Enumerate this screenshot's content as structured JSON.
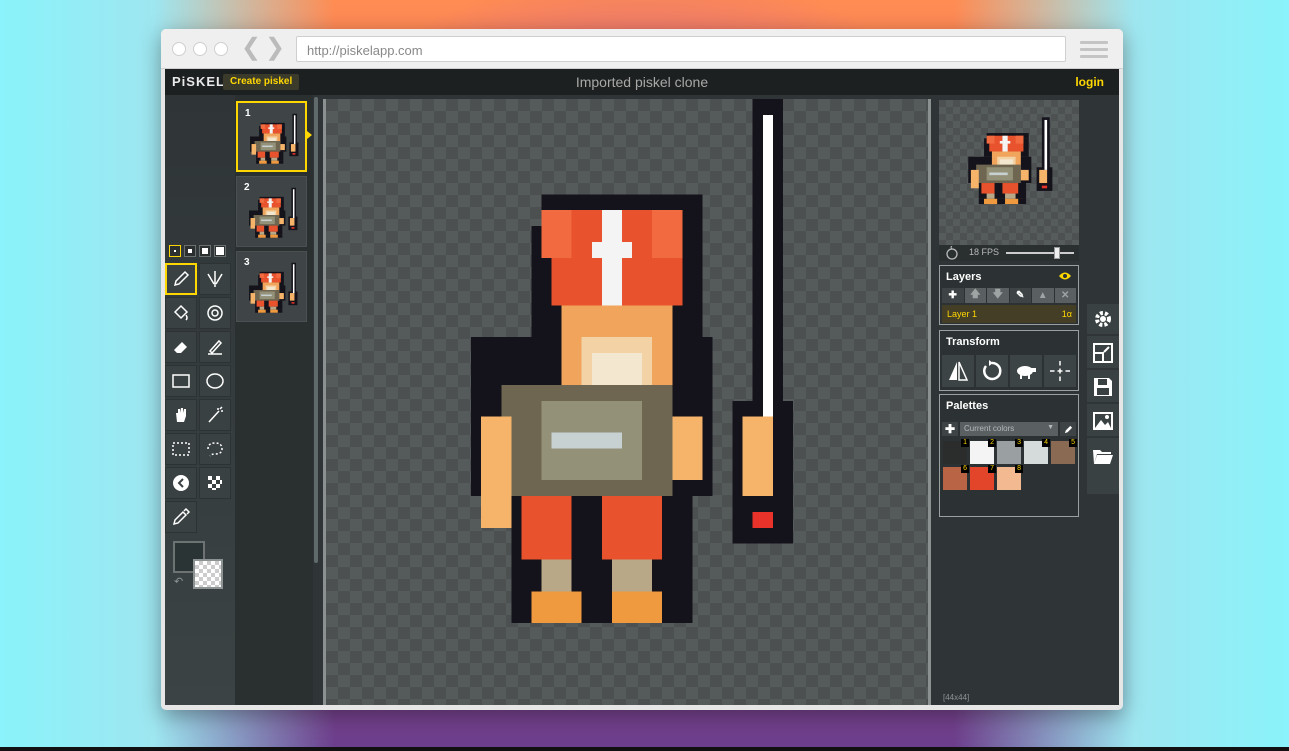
{
  "browser": {
    "url": "http://piskelapp.com"
  },
  "app": {
    "logo": "PiSKEL",
    "create_button": "Create piskel",
    "document_title": "Imported piskel clone",
    "login": "login"
  },
  "tools": {
    "pen_sizes": 4,
    "items": [
      "pen-tool",
      "vertical-mirror-pen-tool",
      "paint-bucket-tool",
      "paint-all-same-color-tool",
      "eraser-tool",
      "stroke-tool",
      "rectangle-tool",
      "circle-tool",
      "move-tool",
      "shape-selection-tool",
      "rectangle-selection-tool",
      "lasso-selection-tool",
      "lighten-tool",
      "dithering-tool",
      "color-picker-tool"
    ],
    "selected": "pen-tool",
    "primary_color": "#2b3434",
    "secondary_color": "transparent"
  },
  "frames": {
    "items": [
      {
        "number": "1"
      },
      {
        "number": "2"
      },
      {
        "number": "3"
      }
    ],
    "selected_index": 0
  },
  "preview": {
    "fps_label": "18 FPS",
    "fps_fraction": 0.75
  },
  "layers": {
    "title": "Layers",
    "items": [
      {
        "name": "Layer 1",
        "opacity": "1α"
      }
    ]
  },
  "transform": {
    "title": "Transform"
  },
  "palettes": {
    "title": "Palettes",
    "selected": "Current colors",
    "swatches": [
      {
        "index": "1",
        "color": "#2b2c2c"
      },
      {
        "index": "2",
        "color": "#f4f4f4"
      },
      {
        "index": "3",
        "color": "#9aa0a2"
      },
      {
        "index": "4",
        "color": "#d5dbdb"
      },
      {
        "index": "5",
        "color": "#8a6a53"
      },
      {
        "index": "6",
        "color": "#b96545"
      },
      {
        "index": "7",
        "color": "#e3452a"
      },
      {
        "index": "8",
        "color": "#f3b990"
      }
    ]
  },
  "canvas": {
    "size_label": "[44x44]"
  },
  "colors": {
    "accent": "#ffd700"
  }
}
